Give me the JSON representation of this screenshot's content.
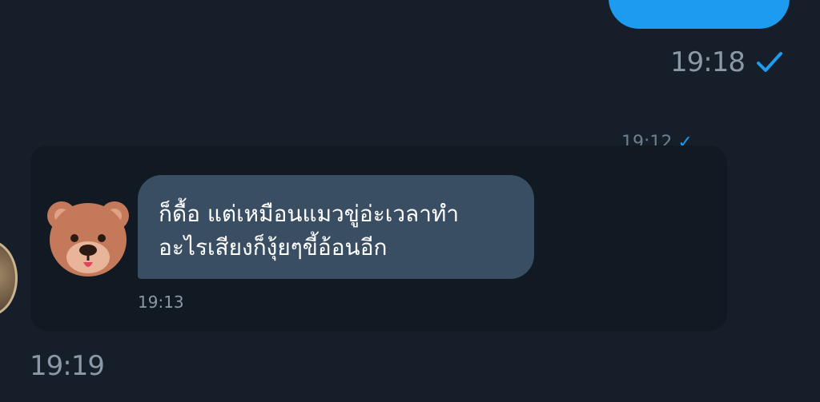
{
  "outgoing": {
    "time": "19:18",
    "status_icon": "check-icon",
    "bubble_color": "#1d9bf0"
  },
  "quoted_card": {
    "partial_time": "19:12"
  },
  "incoming": {
    "avatar_icon": "bear-face-icon",
    "text": "ก็ดื้อ แต่เหมือนแมวขู่อ่ะเวลาทำ\nอะไรเสียงก็งุ้ยๆขี้อ้อนอีก",
    "time": "19:13",
    "bubble_color": "#3a4e63"
  },
  "footer": {
    "time": "19:19"
  },
  "colors": {
    "background": "#151e29",
    "muted_text": "#8b98a5",
    "accent": "#1d9bf0"
  }
}
